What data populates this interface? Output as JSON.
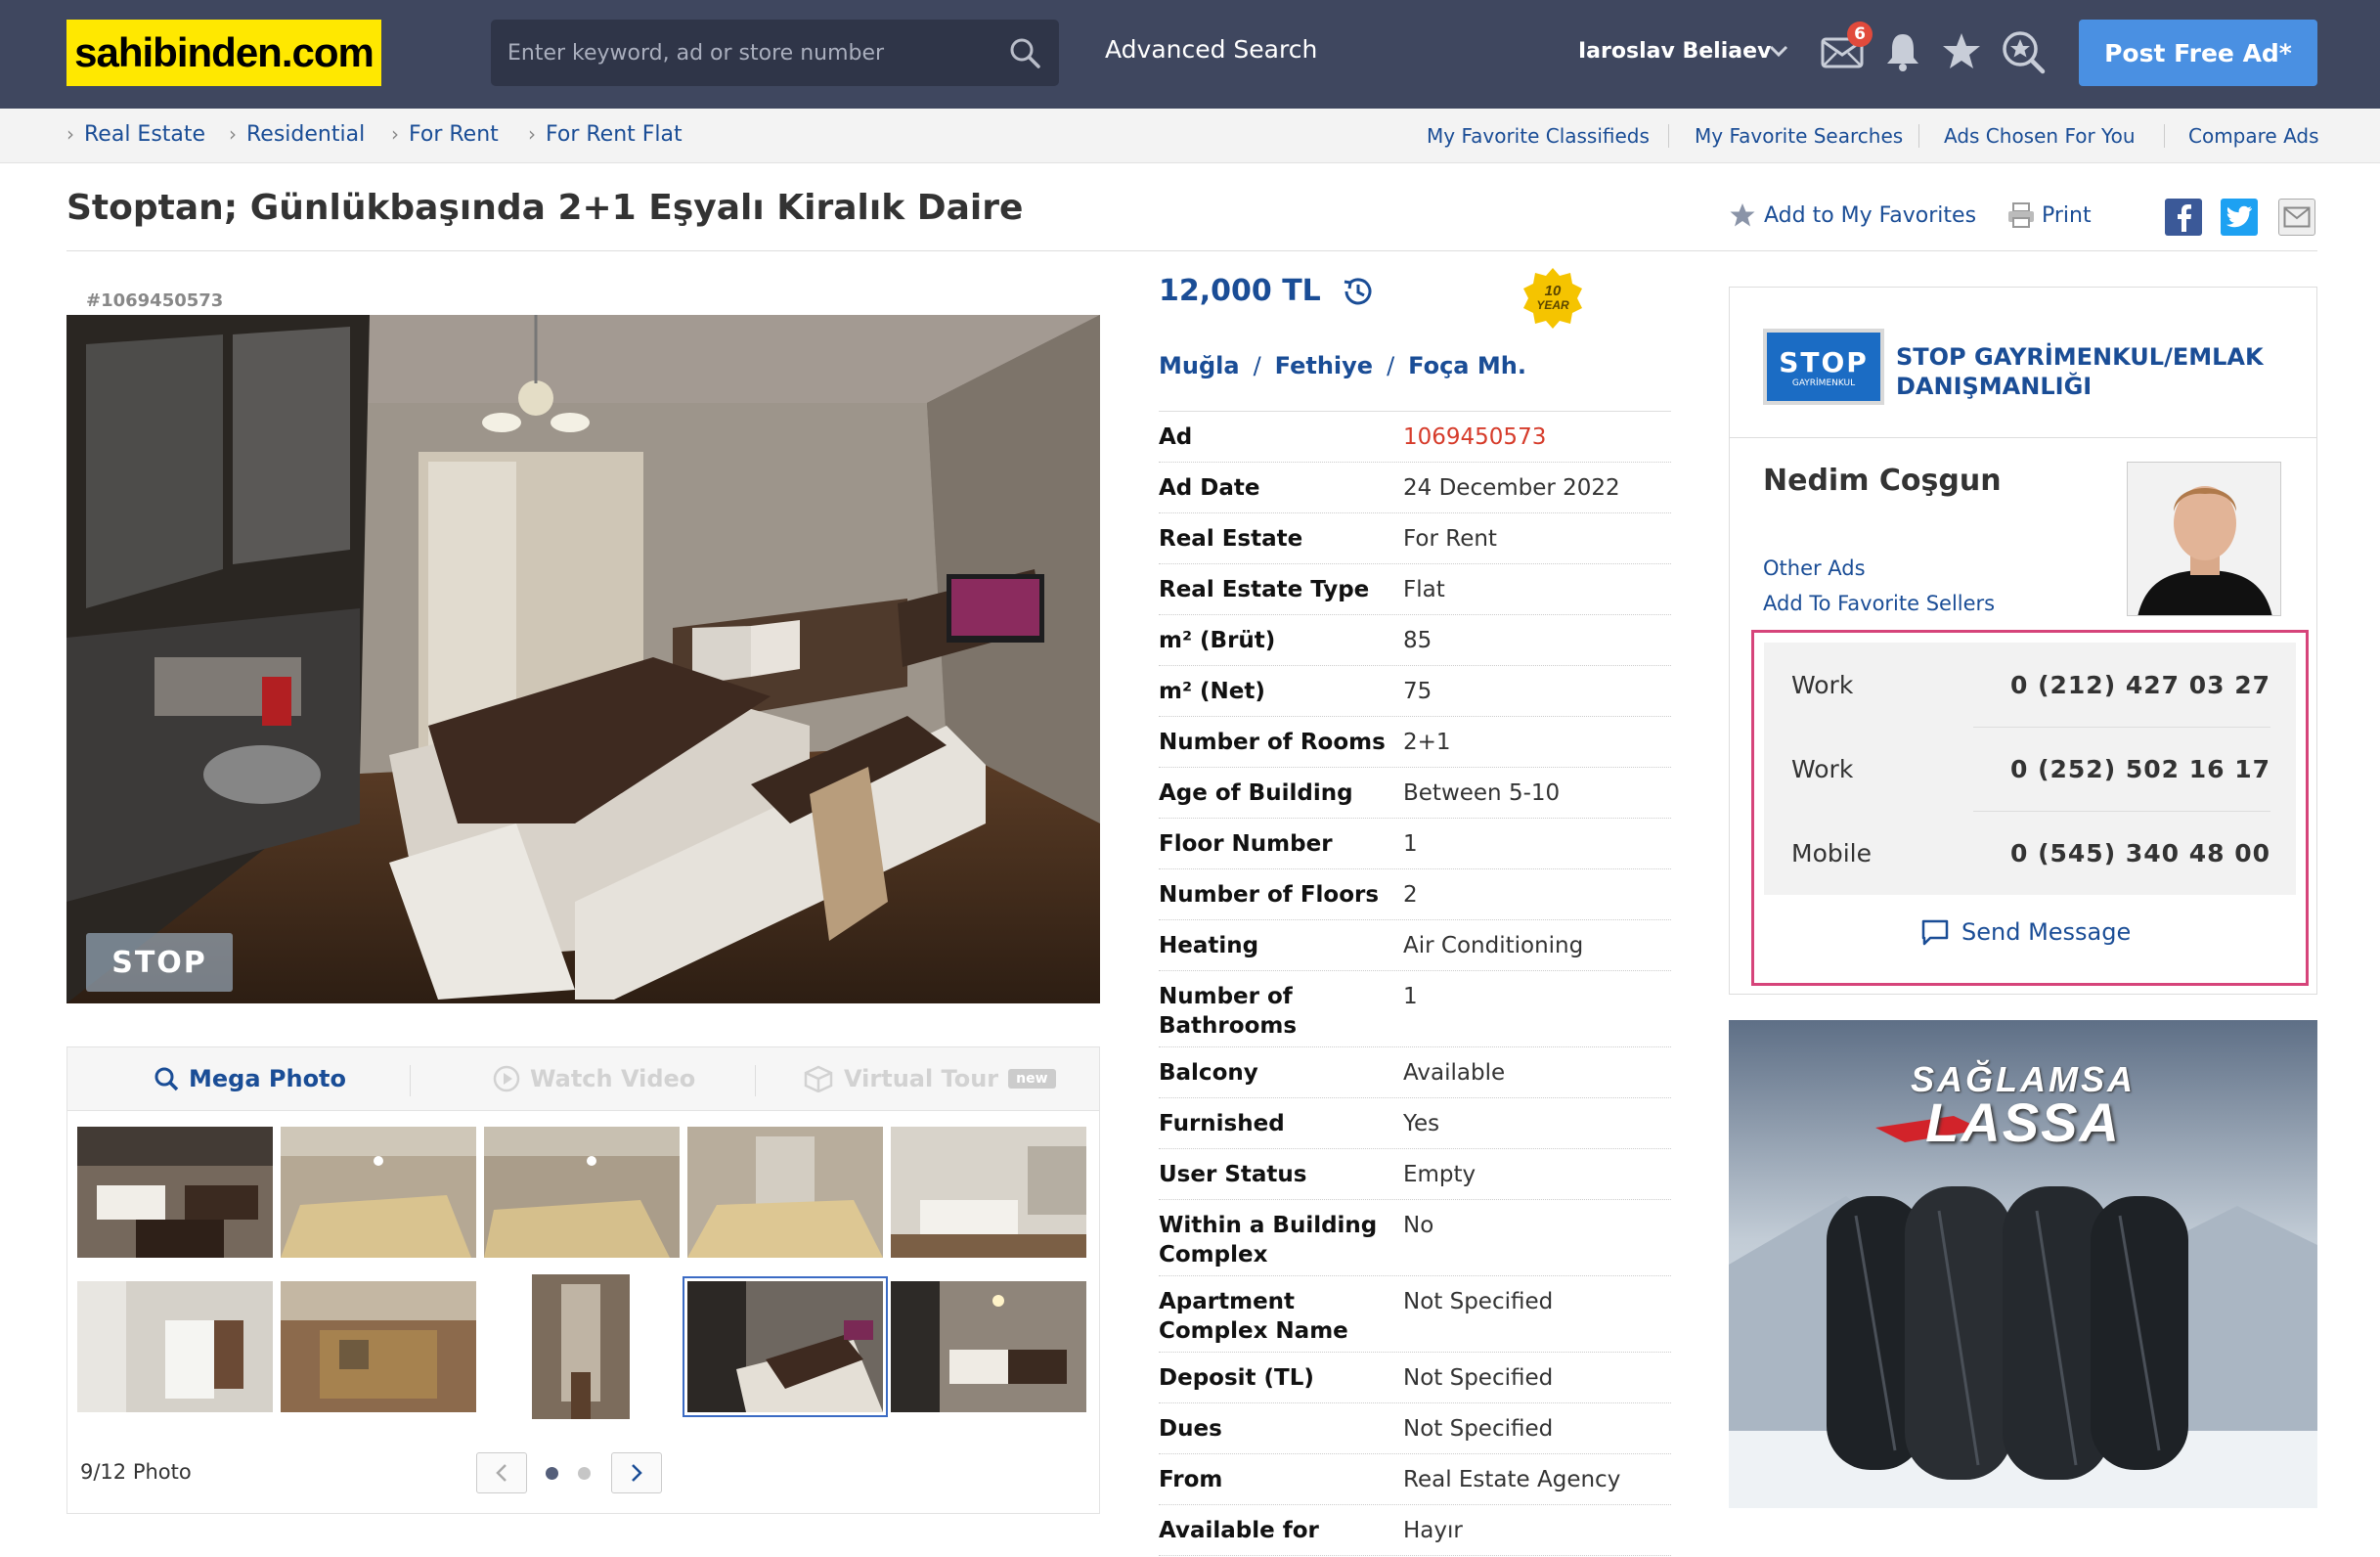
{
  "header": {
    "logo_text": "sahibinden.com",
    "search_placeholder": "Enter keyword, ad or store number",
    "advanced_search": "Advanced Search",
    "user_name": "Iaroslav Beliaev",
    "message_count": "6",
    "post_button": "Post Free Ad*",
    "icons": [
      "envelope-icon",
      "bell-icon",
      "star-icon",
      "search-favorite-icon"
    ],
    "colors": {
      "header_bg": "#3f475f",
      "logo_bg": "#ffe800",
      "post_btn": "#4a90e2"
    }
  },
  "breadcrumbs": [
    "Real Estate",
    "Residential",
    "For Rent",
    "For Rent Flat"
  ],
  "subnav_links": [
    "My Favorite Classifieds",
    "My Favorite Searches",
    "Ads Chosen For You",
    "Compare Ads"
  ],
  "listing": {
    "title": "Stoptan; Günlükbaşında 2+1 Eşyalı Kiralık Daire",
    "add_favorite": "Add to My Favorites",
    "print": "Print",
    "ad_id_label": "#1069450573",
    "photo_watermark": "STOP",
    "price": "12,000 TL",
    "location": {
      "city": "Muğla",
      "district": "Fethiye",
      "neighborhood": "Foça Mh."
    }
  },
  "photo_tabs": {
    "mega_photo": "Mega Photo",
    "watch_video": "Watch Video",
    "virtual_tour": "Virtual Tour",
    "new_badge": "new"
  },
  "gallery": {
    "counter": "9/12 Photo",
    "selected_index": 8
  },
  "details": [
    {
      "k": "Ad",
      "v": "1069450573"
    },
    {
      "k": "Ad Date",
      "v": "24 December 2022"
    },
    {
      "k": "Real Estate",
      "v": "For Rent"
    },
    {
      "k": "Real Estate Type",
      "v": "Flat"
    },
    {
      "k": "m² (Brüt)",
      "v": "85"
    },
    {
      "k": "m² (Net)",
      "v": "75"
    },
    {
      "k": "Number of Rooms",
      "v": "2+1"
    },
    {
      "k": "Age of Building",
      "v": "Between 5-10"
    },
    {
      "k": "Floor Number",
      "v": "1"
    },
    {
      "k": "Number of Floors",
      "v": "2"
    },
    {
      "k": "Heating",
      "v": "Air Conditioning"
    },
    {
      "k": "Number of Bathrooms",
      "v": "1"
    },
    {
      "k": "Balcony",
      "v": "Available"
    },
    {
      "k": "Furnished",
      "v": "Yes"
    },
    {
      "k": "User Status",
      "v": "Empty"
    },
    {
      "k": "Within a Building Complex",
      "v": "No"
    },
    {
      "k": "Apartment Complex Name",
      "v": "Not Specified"
    },
    {
      "k": "Deposit (TL)",
      "v": "Not Specified"
    },
    {
      "k": "Dues",
      "v": "Not Specified"
    },
    {
      "k": "From",
      "v": "Real Estate Agency"
    },
    {
      "k": "Available for",
      "v": "Hayır"
    }
  ],
  "seller": {
    "year_badge": {
      "number": "10",
      "word": "YEAR"
    },
    "store_logo_text": "STOP",
    "store_logo_sub": "GAYRİMENKUL",
    "store_name": "STOP GAYRİMENKUL/EMLAK DANIŞMANLIĞI",
    "name": "Nedim Coşgun",
    "other_ads": "Other Ads",
    "add_favorite_seller": "Add To Favorite Sellers",
    "phones": [
      {
        "label": "Work",
        "number": "0 (212) 427 03 27"
      },
      {
        "label": "Work",
        "number": "0 (252) 502 16 17"
      },
      {
        "label": "Mobile",
        "number": "0 (545) 340 48 00"
      }
    ],
    "send_message": "Send Message",
    "highlight_color": "#d6447a"
  },
  "banner": {
    "line1": "SAĞLAMSA",
    "line2": "LASSA"
  }
}
